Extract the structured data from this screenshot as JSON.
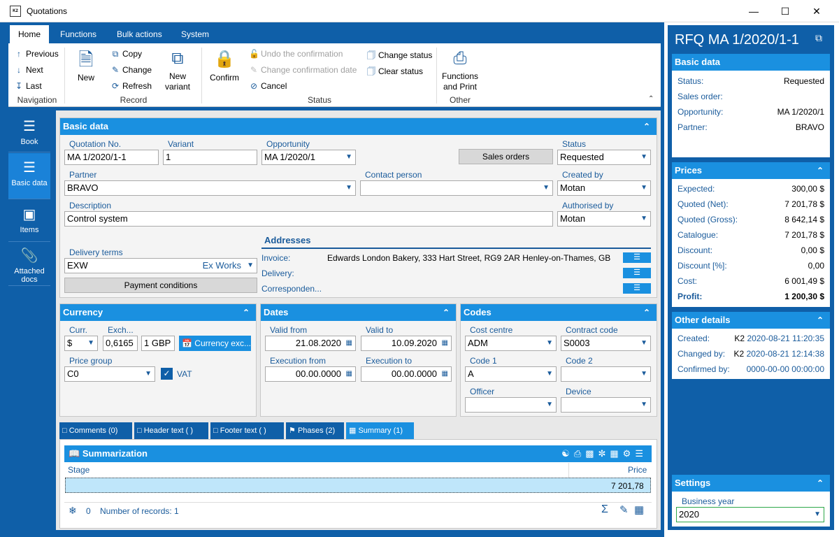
{
  "window": {
    "title": "Quotations",
    "logo": "K2"
  },
  "ribbon": {
    "tabs": [
      "Home",
      "Functions",
      "Bulk actions",
      "System"
    ],
    "navigation": {
      "label": "Navigation",
      "previous": "Previous",
      "next": "Next",
      "last": "Last"
    },
    "record": {
      "label": "Record",
      "new": "New",
      "copy": "Copy",
      "change": "Change",
      "refresh": "Refresh",
      "new_variant_1": "New",
      "new_variant_2": "variant"
    },
    "status": {
      "label": "Status",
      "confirm": "Confirm",
      "undo": "Undo the confirmation",
      "change_date": "Change confirmation date",
      "cancel": "Cancel",
      "change_status": "Change status",
      "clear_status": "Clear status"
    },
    "other": {
      "label": "Other",
      "functions_1": "Functions",
      "functions_2": "and Print"
    }
  },
  "leftnav": [
    "Book",
    "Basic data",
    "Items",
    "Attached docs"
  ],
  "basic": {
    "title": "Basic data",
    "quotation_no_label": "Quotation No.",
    "quotation_no": "MA 1/2020/1-1",
    "variant_label": "Variant",
    "variant": "1",
    "opportunity_label": "Opportunity",
    "opportunity": "MA 1/2020/1",
    "sales_orders_btn": "Sales orders",
    "status_label": "Status",
    "status": "Requested",
    "partner_label": "Partner",
    "partner": "BRAVO",
    "contact_label": "Contact person",
    "contact": "",
    "created_by_label": "Created by",
    "created_by": "Motan",
    "description_label": "Description",
    "description": "Control system",
    "authorised_label": "Authorised by",
    "authorised": "Motan",
    "delivery_terms_label": "Delivery terms",
    "delivery_terms": "EXW",
    "delivery_terms_desc": "Ex Works",
    "payment_btn": "Payment conditions",
    "addresses_label": "Addresses",
    "invoice_label": "Invoice:",
    "invoice": "Edwards London Bakery,  333  Hart Street, RG9 2AR  Henley-on-Thames, GB",
    "delivery_label": "Delivery:",
    "corresp_label": "Corresponden..."
  },
  "currency": {
    "title": "Currency",
    "curr_label": "Curr.",
    "curr": "$",
    "exch_label": "Exch...",
    "exch": "0,6165",
    "unit": "1 GBP",
    "exch_btn": "Currency exc...",
    "price_group_label": "Price group",
    "price_group": "C0",
    "vat_label": "VAT"
  },
  "dates": {
    "title": "Dates",
    "valid_from_label": "Valid from",
    "valid_from": "21.08.2020",
    "valid_to_label": "Valid to",
    "valid_to": "10.09.2020",
    "exec_from_label": "Execution from",
    "exec_from": "00.00.0000",
    "exec_to_label": "Execution to",
    "exec_to": "00.00.0000"
  },
  "codes": {
    "title": "Codes",
    "cost_centre_label": "Cost centre",
    "cost_centre": "ADM",
    "contract_label": "Contract code",
    "contract": "S0003",
    "code1_label": "Code 1",
    "code1": "A",
    "code2_label": "Code 2",
    "code2": "",
    "officer_label": "Officer",
    "device_label": "Device"
  },
  "bottom_tabs": [
    "Comments (0)",
    "Header text ( )",
    "Footer text ( )",
    "Phases (2)",
    "Summary (1)"
  ],
  "summary": {
    "title": "Summarization",
    "col_stage": "Stage",
    "col_price": "Price",
    "price": "7 201,78",
    "count": "0",
    "records": "Number of records: 1"
  },
  "right": {
    "title": "RFQ  MA 1/2020/1-1",
    "basic_title": "Basic data",
    "basic": [
      [
        "Status:",
        "Requested"
      ],
      [
        "Sales order:",
        ""
      ],
      [
        "Opportunity:",
        "MA 1/2020/1"
      ],
      [
        "Partner:",
        "BRAVO"
      ]
    ],
    "prices_title": "Prices",
    "prices": [
      [
        "Expected:",
        "300,00 $"
      ],
      [
        "Quoted (Net):",
        "7 201,78 $"
      ],
      [
        "Quoted (Gross):",
        "8 642,14 $"
      ],
      [
        "Catalogue:",
        "7 201,78 $"
      ],
      [
        "Discount:",
        "0,00 $"
      ],
      [
        "Discount [%]:",
        "0,00"
      ],
      [
        "Cost:",
        "6 001,49 $"
      ],
      [
        "Profit:",
        "1 200,30 $"
      ]
    ],
    "other_title": "Other details",
    "other": [
      [
        "Created:",
        "K2",
        "2020-08-21 11:20:35"
      ],
      [
        "Changed by:",
        "K2",
        "2020-08-21 12:14:38"
      ],
      [
        "Confirmed by:",
        "",
        "0000-00-00 00:00:00"
      ]
    ],
    "settings_title": "Settings",
    "business_year_label": "Business year",
    "business_year": "2020"
  }
}
